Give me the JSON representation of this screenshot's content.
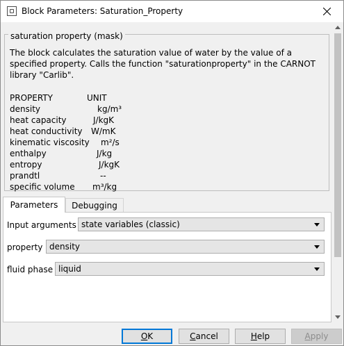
{
  "window": {
    "title": "Block Parameters: Saturation_Property"
  },
  "description": {
    "legend": "saturation property (mask)",
    "paragraph": "The block calculates the saturation value of water by the value of a specified property. Calls the function \"saturationproperty\" in the CARNOT library \"Carlib\".",
    "header": {
      "name": "PROPERTY",
      "unit": "UNIT"
    },
    "rows": [
      {
        "name": "density",
        "unit": "kg/m³"
      },
      {
        "name": "heat capacity",
        "unit": "J/kgK"
      },
      {
        "name": "heat conductivity",
        "unit": "W/mK"
      },
      {
        "name": "kinematic viscosity",
        "unit": "m²/s"
      },
      {
        "name": "enthalpy",
        "unit": "J/kg"
      },
      {
        "name": "entropy",
        "unit": "J/kgK"
      },
      {
        "name": "prandtl",
        "unit": "--"
      },
      {
        "name": "specific volume",
        "unit": "m³/kg"
      }
    ]
  },
  "tabs": [
    {
      "label": "Parameters",
      "active": true
    },
    {
      "label": "Debugging",
      "active": false
    }
  ],
  "params": {
    "input_arguments": {
      "label": "Input arguments",
      "value": "state variables (classic)"
    },
    "property": {
      "label": "property",
      "value": "density"
    },
    "fluid_phase": {
      "label": "fluid phase",
      "value": "liquid"
    }
  },
  "buttons": {
    "ok": {
      "label": "OK",
      "mnemonic": "O",
      "rest": "K"
    },
    "cancel": {
      "label": "Cancel",
      "mnemonic": "C",
      "rest": "ancel"
    },
    "help": {
      "label": "Help",
      "mnemonic": "H",
      "rest": "elp"
    },
    "apply": {
      "label": "Apply",
      "mnemonic": "A",
      "rest": "pply"
    }
  },
  "colors": {
    "accent": "#0078d7",
    "dropdown_bg": "#e5e5e5",
    "panel_bg": "#ffffff",
    "window_bg": "#f0f0f0"
  }
}
